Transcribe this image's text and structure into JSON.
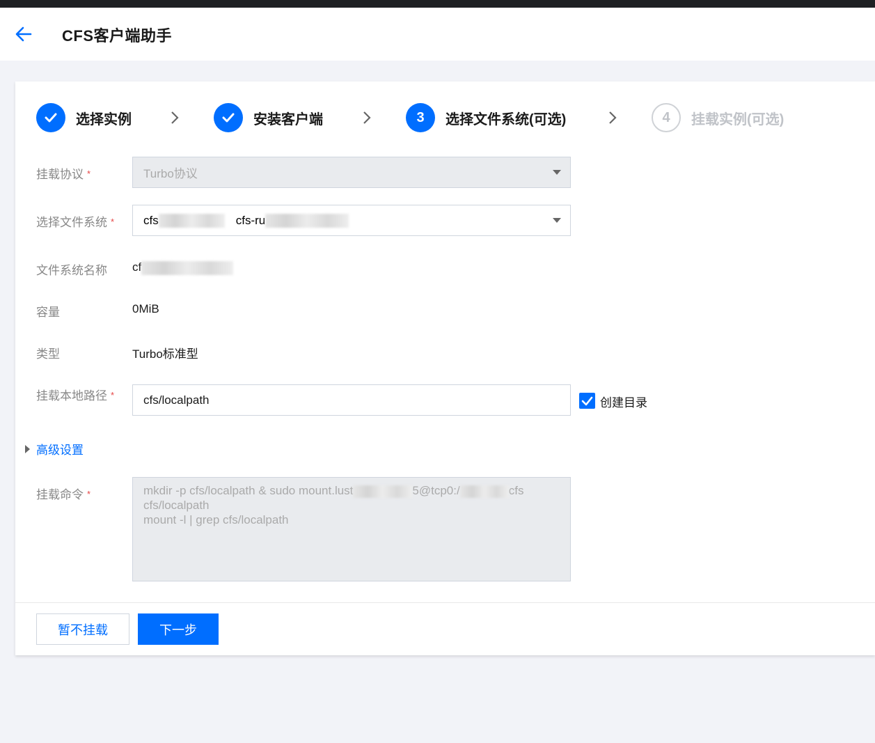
{
  "header": {
    "title": "CFS客户端助手"
  },
  "steps": [
    {
      "label": "选择实例",
      "state": "done",
      "number": ""
    },
    {
      "label": "安装客户端",
      "state": "done",
      "number": ""
    },
    {
      "label": "选择文件系统(可选)",
      "state": "active",
      "number": "3"
    },
    {
      "label": "挂载实例(可选)",
      "state": "todo",
      "number": "4"
    }
  ],
  "form": {
    "protocol": {
      "label": "挂载协议",
      "value": "Turbo协议"
    },
    "filesystem": {
      "label": "选择文件系统",
      "value_a": "cfs",
      "value_b": "cfs-ru"
    },
    "fs_name": {
      "label": "文件系统名称",
      "value": "cf"
    },
    "capacity": {
      "label": "容量",
      "value": "0MiB"
    },
    "type": {
      "label": "类型",
      "value": "Turbo标准型"
    },
    "local_path": {
      "label": "挂载本地路径",
      "value": "cfs/localpath"
    },
    "create_dir": {
      "label": "创建目录",
      "checked": true
    },
    "advanced": {
      "label": "高级设置"
    },
    "command": {
      "label": "挂载命令",
      "line1a": "mkdir -p cfs/localpath & sudo mount.lust",
      "line1b": "5@tcp0:/",
      "line1c": "cfs",
      "line2": "cfs/localpath",
      "line3": "mount -l | grep cfs/localpath"
    },
    "required_mark": "*"
  },
  "buttons": {
    "skip": "暂不挂载",
    "next": "下一步"
  },
  "colors": {
    "primary": "#006eff",
    "required": "#e54545"
  }
}
